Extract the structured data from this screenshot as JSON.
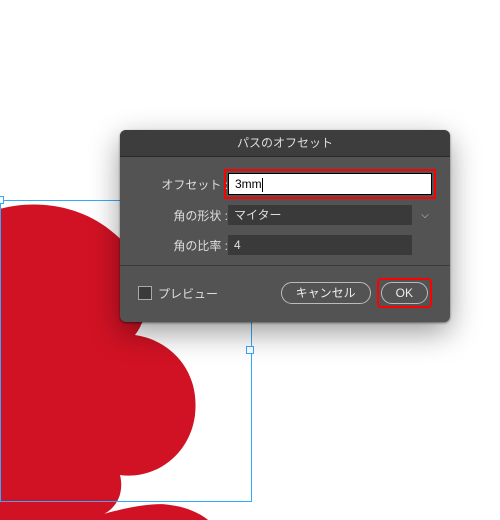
{
  "dialog": {
    "title": "パスのオフセット",
    "offset": {
      "label": "オフセット :",
      "value": "3mm"
    },
    "join": {
      "label": "角の形状 :",
      "value": "マイター"
    },
    "miter": {
      "label": "角の比率 :",
      "value": "4"
    },
    "preview_label": "プレビュー",
    "cancel_label": "キャンセル",
    "ok_label": "OK"
  },
  "colors": {
    "shape": "#d11224",
    "highlight": "#ff0000",
    "selection": "#33aaff"
  }
}
